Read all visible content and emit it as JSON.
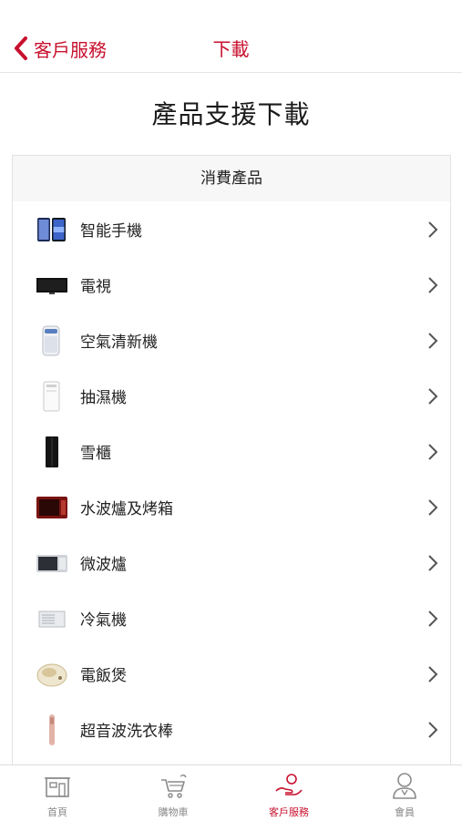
{
  "header": {
    "back_label": "客戶服務",
    "title": "下載",
    "accent_color": "#c8102e"
  },
  "page_title": "產品支援下載",
  "section": {
    "title": "消費產品",
    "items": [
      {
        "label": "智能手機",
        "icon": "smartphone-icon"
      },
      {
        "label": "電視",
        "icon": "tv-icon"
      },
      {
        "label": "空氣清新機",
        "icon": "air-purifier-icon"
      },
      {
        "label": "抽濕機",
        "icon": "dehumidifier-icon"
      },
      {
        "label": "雪櫃",
        "icon": "fridge-icon"
      },
      {
        "label": "水波爐及烤箱",
        "icon": "oven-icon"
      },
      {
        "label": "微波爐",
        "icon": "microwave-icon"
      },
      {
        "label": "冷氣機",
        "icon": "air-conditioner-icon"
      },
      {
        "label": "電飯煲",
        "icon": "rice-cooker-icon"
      },
      {
        "label": "超音波洗衣棒",
        "icon": "ultrasonic-washer-icon"
      }
    ]
  },
  "tabbar": {
    "tabs": [
      {
        "label": "首頁",
        "icon": "home-store-icon",
        "active": false
      },
      {
        "label": "購物車",
        "icon": "cart-icon",
        "active": false
      },
      {
        "label": "客戶服務",
        "icon": "customer-service-hand-icon",
        "active": true
      },
      {
        "label": "會員",
        "icon": "member-icon",
        "active": false
      }
    ]
  }
}
